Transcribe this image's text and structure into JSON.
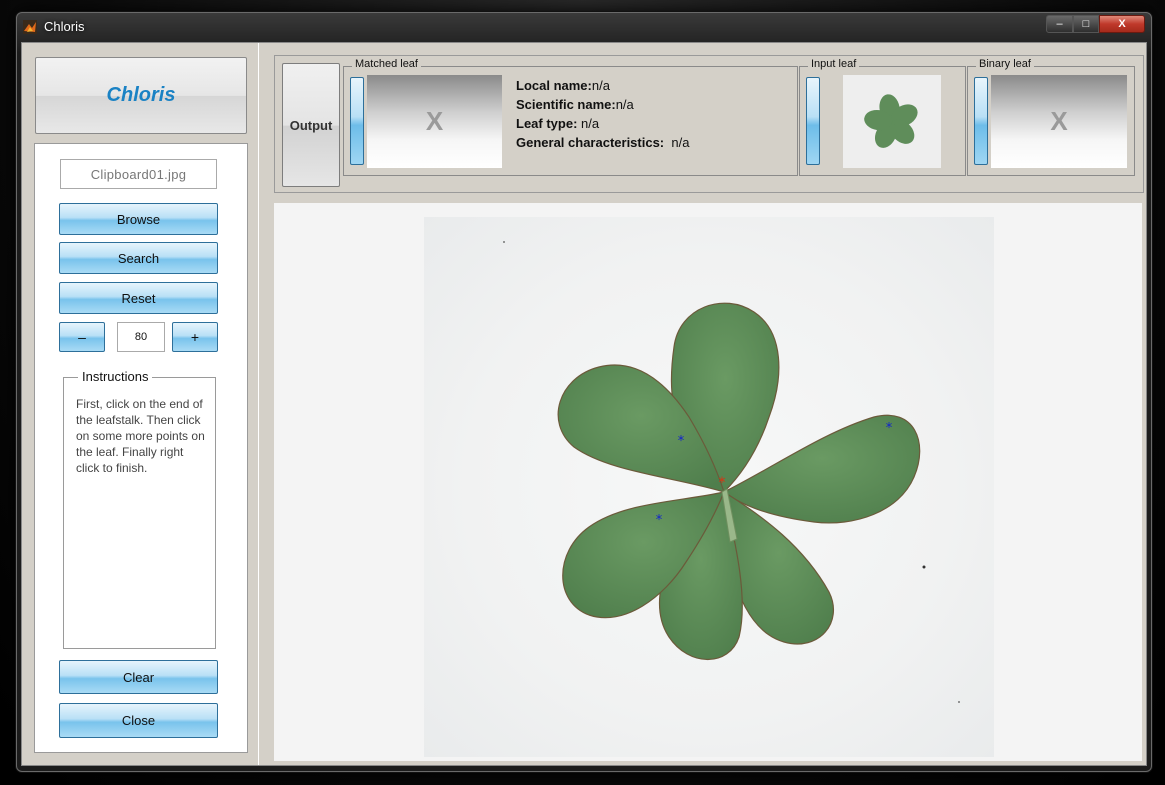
{
  "window": {
    "title": "Chloris",
    "controls": {
      "minimize": "–",
      "maximize": "□",
      "close": "X"
    }
  },
  "sidebar": {
    "logo_text": "Chloris",
    "file_name": "Clipboard01.jpg",
    "buttons": {
      "browse": "Browse",
      "search": "Search",
      "reset": "Reset",
      "decrease": "–",
      "increase": "+",
      "clear": "Clear",
      "close": "Close"
    },
    "zoom_value": "80",
    "instructions": {
      "title": "Instructions",
      "text": "First, click on the end of the leafstalk. Then click on some more points on the leaf. Finally right click to finish."
    }
  },
  "output_panel": {
    "output_button": "Output",
    "matched_leaf": {
      "label": "Matched leaf",
      "placeholder": "X",
      "local_name_label": "Local name:",
      "local_name_value": "n/a",
      "scientific_name_label": "Scientific name:",
      "scientific_name_value": "n/a",
      "leaf_type_label": "Leaf type:",
      "leaf_type_value": " n/a",
      "general_label": "General characteristics:",
      "general_value": "  n/a"
    },
    "input_leaf": {
      "label": "Input leaf"
    },
    "binary_leaf": {
      "label": "Binary leaf",
      "placeholder": "X"
    }
  },
  "canvas": {
    "marker_color_selected": "#e03010",
    "marker_color_points": "#1020d0",
    "leaf_color": "#5f8d5a"
  }
}
